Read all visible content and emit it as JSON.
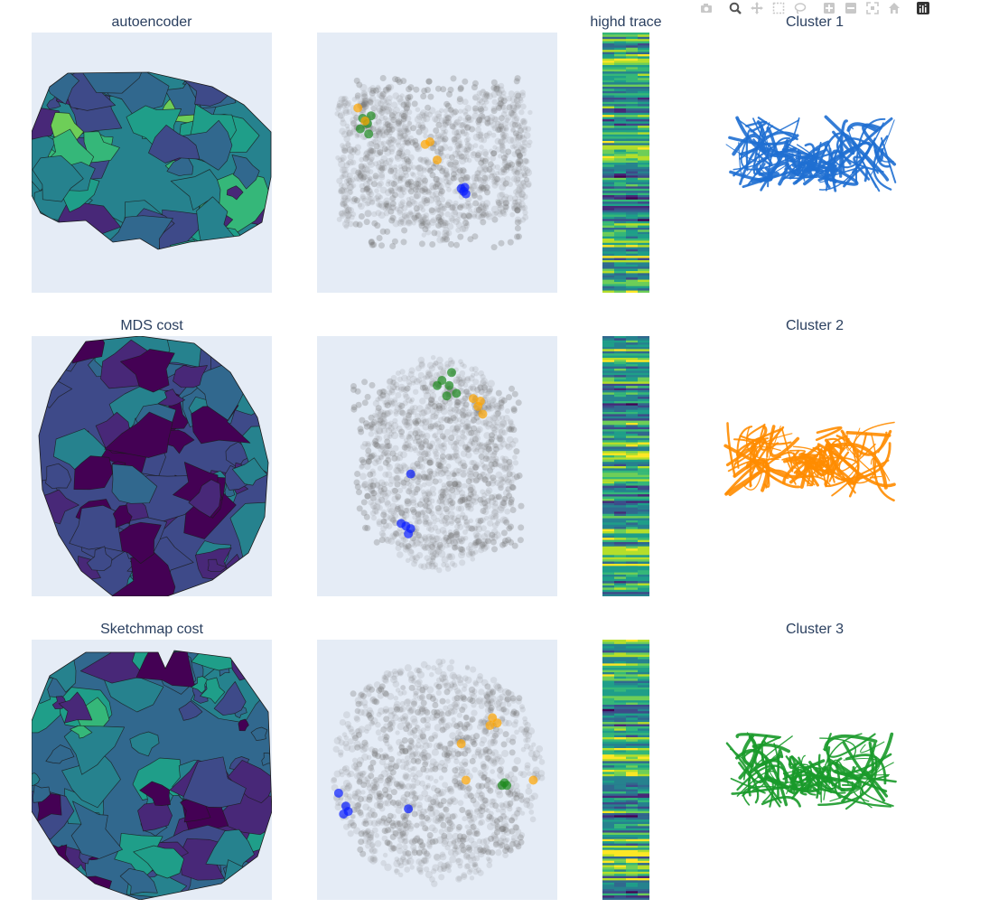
{
  "modebar": {
    "icons": [
      "camera-icon",
      "zoom-icon",
      "pan-icon",
      "box-select-icon",
      "lasso-icon",
      "zoom-in-icon",
      "zoom-out-icon",
      "autoscale-icon",
      "reset-axes-icon",
      "plotly-logo-icon"
    ]
  },
  "titles": {
    "row1_left": "autoencoder",
    "row2_left": "MDS cost",
    "row3_left": "Sketchmap cost",
    "heatmap": "highd trace",
    "cluster1": "Cluster 1",
    "cluster2": "Cluster 2",
    "cluster3": "Cluster 3"
  },
  "colors": {
    "plot_bg": "#e5ecf6",
    "grey_points": "#707070",
    "cluster_blue": "#0a1eff",
    "cluster_orange": "#ffa500",
    "cluster_green": "#1e8a1e",
    "protein_1": "#1f6fd1",
    "protein_2": "#ff8c00",
    "protein_3": "#1a9a2a",
    "viridis": [
      "#440154",
      "#482878",
      "#3e4a89",
      "#31688e",
      "#26828e",
      "#1f9e89",
      "#35b779",
      "#6ece58",
      "#b5de2b",
      "#fde725"
    ]
  },
  "chart_data": [
    {
      "type": "heatmap",
      "title": "autoencoder",
      "colorscale": "viridis",
      "contour": true,
      "shape": "irregular blob with ragged lower-left edge"
    },
    {
      "type": "scatter",
      "title": "",
      "series": [
        {
          "color": "grey",
          "role": "background",
          "shape": "elongated streaks"
        },
        {
          "color": "green",
          "points": [
            [
              -0.62,
              0.34
            ],
            [
              -0.58,
              0.3
            ],
            [
              -0.55,
              0.36
            ],
            [
              -0.64,
              0.26
            ],
            [
              -0.57,
              0.22
            ]
          ]
        },
        {
          "color": "orange",
          "points": [
            [
              -0.66,
              0.42
            ],
            [
              -0.1,
              0.14
            ],
            [
              -0.06,
              0.16
            ],
            [
              0.0,
              0.02
            ],
            [
              -0.6,
              0.32
            ]
          ]
        },
        {
          "color": "blue",
          "points": [
            [
              0.22,
              -0.22
            ],
            [
              0.24,
              -0.24
            ],
            [
              0.2,
              -0.2
            ],
            [
              0.23,
              -0.19
            ]
          ]
        }
      ]
    },
    {
      "type": "heatmap",
      "title": "highd trace",
      "colorscale": "viridis",
      "rows": 120,
      "cols": 1
    },
    {
      "type": "heatmap",
      "title": "MDS cost",
      "colorscale": "viridis",
      "contour": true,
      "shape": "tilted oval blob"
    },
    {
      "type": "scatter",
      "title": "",
      "series": [
        {
          "color": "grey",
          "role": "background",
          "shape": "egg-shaped cloud"
        },
        {
          "color": "green",
          "points": [
            [
              0.04,
              0.66
            ],
            [
              0.1,
              0.62
            ],
            [
              0.0,
              0.62
            ],
            [
              0.12,
              0.72
            ],
            [
              0.08,
              0.54
            ],
            [
              0.16,
              0.56
            ]
          ]
        },
        {
          "color": "orange",
          "points": [
            [
              0.3,
              0.52
            ],
            [
              0.34,
              0.46
            ],
            [
              0.36,
              0.5
            ],
            [
              0.38,
              0.4
            ]
          ]
        },
        {
          "color": "blue",
          "points": [
            [
              -0.22,
              -0.06
            ],
            [
              -0.3,
              -0.44
            ],
            [
              -0.26,
              -0.46
            ],
            [
              -0.22,
              -0.48
            ],
            [
              -0.24,
              -0.52
            ]
          ]
        }
      ]
    },
    {
      "type": "heatmap",
      "title": "",
      "colorscale": "viridis",
      "rows": 120,
      "cols": 1
    },
    {
      "type": "heatmap",
      "title": "Sketchmap cost",
      "colorscale": "viridis",
      "contour": true,
      "shape": "octagonal blob with top notch"
    },
    {
      "type": "scatter",
      "title": "",
      "series": [
        {
          "color": "grey",
          "role": "background",
          "shape": "round cloud"
        },
        {
          "color": "orange",
          "points": [
            [
              0.44,
              0.34
            ],
            [
              0.46,
              0.4
            ],
            [
              0.5,
              0.36
            ],
            [
              0.2,
              0.2
            ],
            [
              0.24,
              -0.08
            ],
            [
              0.8,
              -0.08
            ]
          ]
        },
        {
          "color": "green",
          "points": [
            [
              0.56,
              -0.1
            ],
            [
              0.58,
              -0.12
            ],
            [
              0.54,
              -0.12
            ]
          ]
        },
        {
          "color": "blue",
          "points": [
            [
              -0.82,
              -0.18
            ],
            [
              -0.76,
              -0.28
            ],
            [
              -0.78,
              -0.34
            ],
            [
              -0.74,
              -0.32
            ],
            [
              -0.24,
              -0.3
            ]
          ]
        }
      ]
    },
    {
      "type": "heatmap",
      "title": "",
      "colorscale": "viridis",
      "rows": 120,
      "cols": 1
    }
  ]
}
